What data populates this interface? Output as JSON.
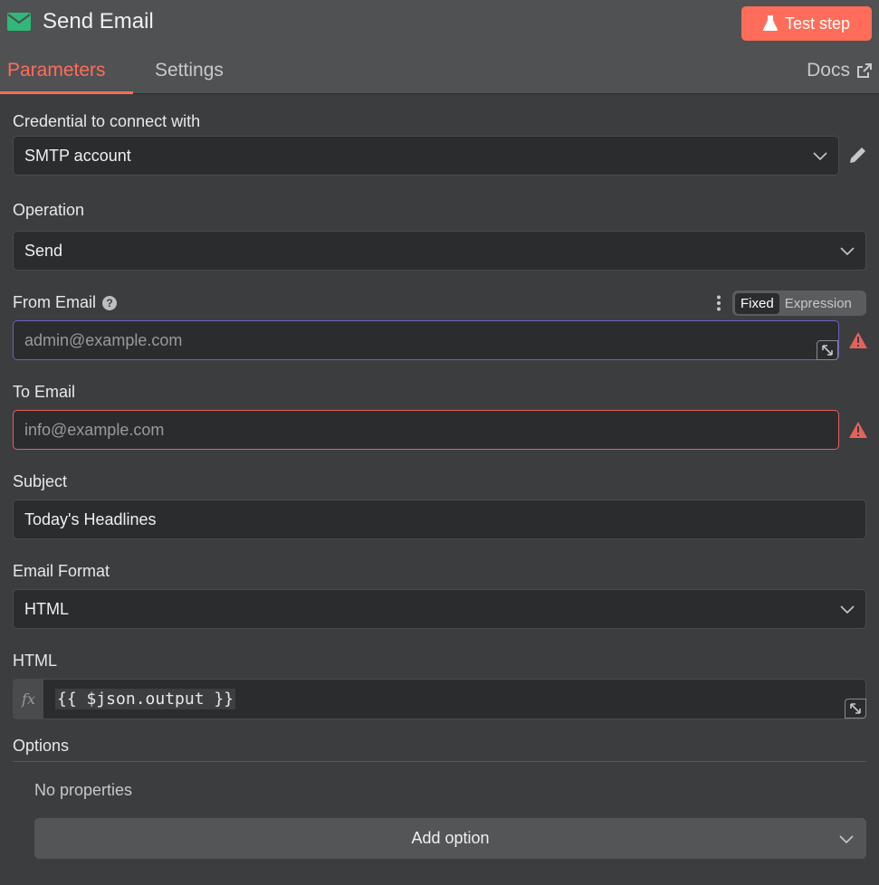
{
  "header": {
    "title": "Send Email",
    "icon": "mail-icon",
    "test_button": "Test step",
    "tabs": [
      "Parameters",
      "Settings"
    ],
    "docs": "Docs"
  },
  "colors": {
    "accent": "#ff6d5a",
    "node_icon": "#2fb879",
    "error": "#e5625a",
    "focus": "#6e5fbf"
  },
  "credential": {
    "label": "Credential to connect with",
    "value": "SMTP account"
  },
  "operation": {
    "label": "Operation",
    "value": "Send"
  },
  "from_email": {
    "label": "From Email",
    "placeholder": "admin@example.com",
    "mode_fixed": "Fixed",
    "mode_expression": "Expression",
    "selected_mode": "Fixed"
  },
  "to_email": {
    "label": "To Email",
    "placeholder": "info@example.com"
  },
  "subject": {
    "label": "Subject",
    "value": "Today's Headlines"
  },
  "email_format": {
    "label": "Email Format",
    "value": "HTML"
  },
  "html": {
    "label": "HTML",
    "fx": "fx",
    "expression": "{{ $json.output }}"
  },
  "options": {
    "label": "Options",
    "empty_text": "No properties",
    "add_button": "Add option"
  }
}
